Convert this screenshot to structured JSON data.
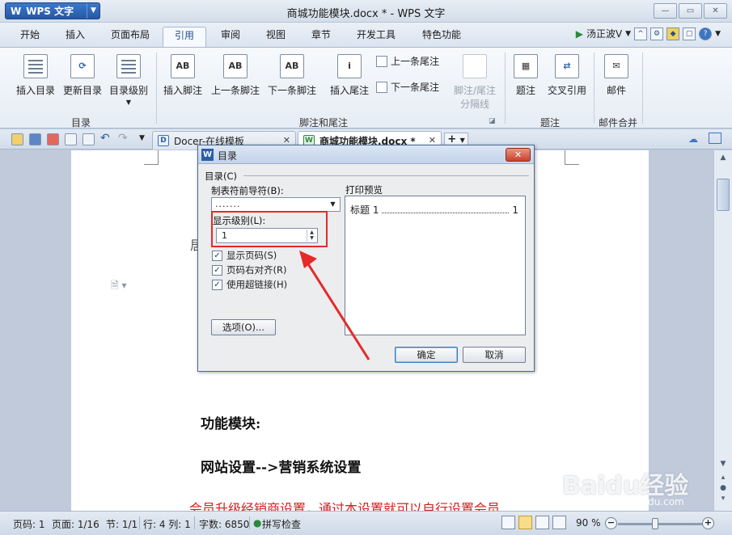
{
  "window": {
    "app_label": "WPS 文字",
    "title": "商城功能模块.docx * - WPS 文字"
  },
  "menu": {
    "tabs": [
      "开始",
      "插入",
      "页面布局",
      "引用",
      "审阅",
      "视图",
      "章节",
      "开发工具",
      "特色功能"
    ],
    "active_tab": "引用",
    "user_name": "汤正波V"
  },
  "ribbon": {
    "groups": [
      {
        "label": "目录",
        "buttons": [
          "插入目录",
          "更新目录",
          "目录级别"
        ]
      },
      {
        "label": "脚注和尾注",
        "buttons": [
          "插入脚注",
          "上一条脚注",
          "下一条脚注",
          "插入尾注"
        ],
        "small_buttons": [
          "上一条尾注",
          "下一条尾注"
        ]
      },
      {
        "label": "",
        "buttons": [
          "脚注/尾注",
          "分隔线"
        ]
      },
      {
        "label": "题注",
        "buttons": [
          "题注",
          "交叉引用"
        ]
      },
      {
        "label": "邮件合并",
        "buttons": [
          "邮件"
        ]
      }
    ]
  },
  "doc_tabs": [
    {
      "label": "Docer-在线模板",
      "active": false
    },
    {
      "label": "商城功能模块.docx *",
      "active": true
    }
  ],
  "document": {
    "partial_char": "居",
    "heading1": "功能模块:",
    "heading2": "网站设置-->营销系统设置",
    "red_text": "会员升级经销商设置，通过本设置就可以自行设置会员"
  },
  "dialog": {
    "title": "目录",
    "section_label": "目录(C)",
    "leader_label": "制表符前导符(B):",
    "leader_value": ".......",
    "level_label": "显示级别(L):",
    "level_value": "1",
    "preview_label": "打印预览",
    "preview_entry": "标题 1",
    "preview_page": "1",
    "checkboxes": [
      {
        "label": "显示页码(S)",
        "checked": true
      },
      {
        "label": "页码右对齐(R)",
        "checked": true
      },
      {
        "label": "使用超链接(H)",
        "checked": true
      }
    ],
    "options_button": "选项(O)...",
    "ok_button": "确定",
    "cancel_button": "取消"
  },
  "status_bar": {
    "page": "页码: 1",
    "pages": "页面: 1/16",
    "section": "节: 1/1",
    "row_col": "行: 4  列: 1",
    "word_count": "字数: 6850",
    "spell_check": "拼写检查",
    "zoom": "90 %"
  },
  "watermark": {
    "brand": "Baidu经验",
    "url": "jingyan.baidu.com"
  },
  "colors": {
    "accent": "#2458a6",
    "annotation_red": "#e52a2a",
    "red_text": "#d01f1f"
  }
}
